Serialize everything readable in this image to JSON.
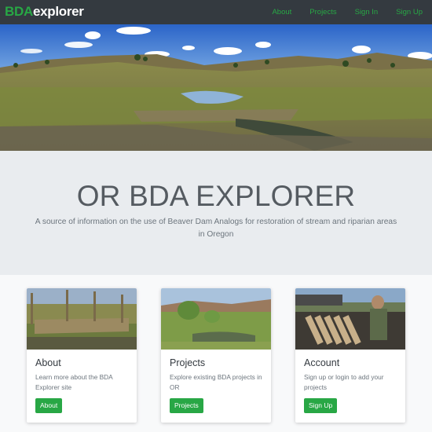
{
  "nav": {
    "brand_bold": "BDA",
    "brand_rest": "explorer",
    "links": [
      "About",
      "Projects",
      "Sign In",
      "Sign Up"
    ]
  },
  "jumbotron": {
    "title": "OR BDA EXPLORER",
    "subtitle": "A source of information on the use of Beaver Dam Analogs for restoration of stream and riparian areas in Oregon"
  },
  "cards": [
    {
      "title": "About",
      "text": "Learn more about the BDA Explorer site",
      "button": "About"
    },
    {
      "title": "Projects",
      "text": "Explore existing BDA projects in OR",
      "button": "Projects"
    },
    {
      "title": "Account",
      "text": "Sign up or login to add your projects",
      "button": "Sign Up"
    }
  ],
  "colors": {
    "accent": "#28a745",
    "navbar": "#343a40",
    "jumbotron": "#e9ecef"
  }
}
